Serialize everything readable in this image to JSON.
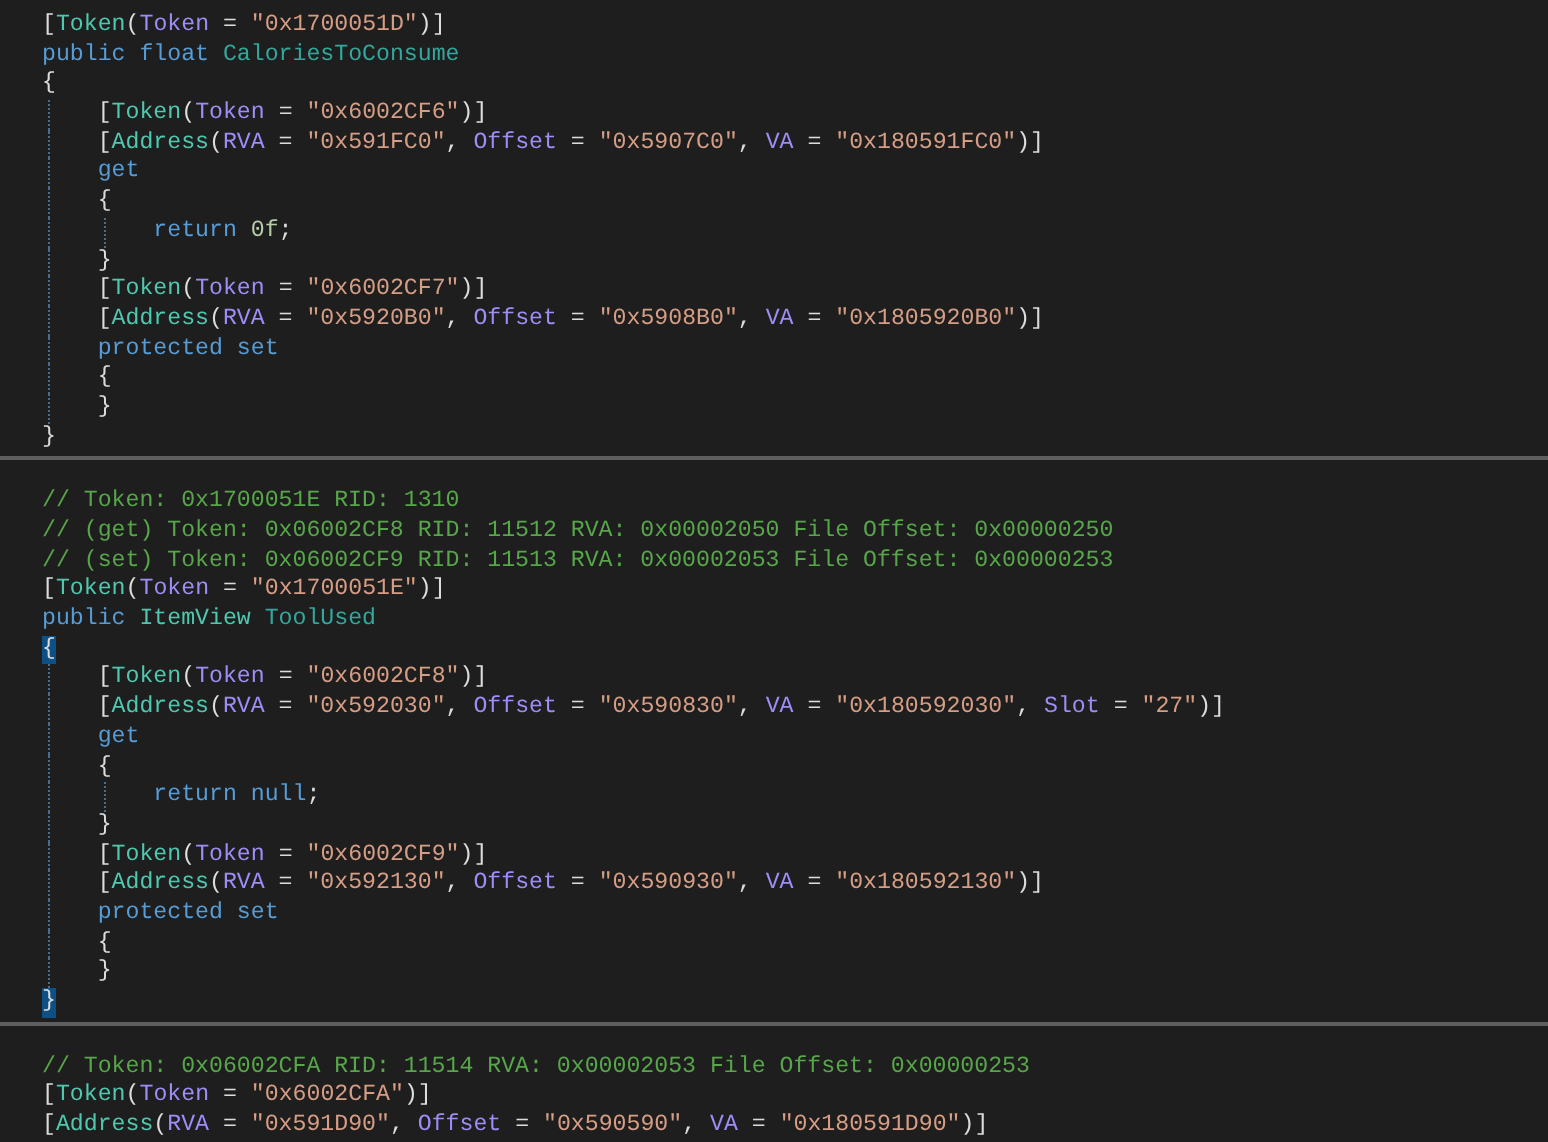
{
  "members": [
    {
      "lines": [
        [
          {
            "kind": "punct",
            "text": "["
          },
          {
            "kind": "attr",
            "text": "Token"
          },
          {
            "kind": "punct",
            "text": "("
          },
          {
            "kind": "param",
            "text": "Token"
          },
          {
            "kind": "punct",
            "text": " = "
          },
          {
            "kind": "string",
            "text": "\"0x1700051D\""
          },
          {
            "kind": "punct",
            "text": ")]"
          }
        ],
        [
          {
            "kind": "keyword",
            "text": "public float "
          },
          {
            "kind": "member",
            "text": "CaloriesToConsume"
          }
        ],
        [
          {
            "kind": "punct",
            "text": "{"
          }
        ],
        [
          {
            "kind": "punct",
            "text": "    ["
          },
          {
            "kind": "attr",
            "text": "Token"
          },
          {
            "kind": "punct",
            "text": "("
          },
          {
            "kind": "param",
            "text": "Token"
          },
          {
            "kind": "punct",
            "text": " = "
          },
          {
            "kind": "string",
            "text": "\"0x6002CF6\""
          },
          {
            "kind": "punct",
            "text": ")]"
          }
        ],
        [
          {
            "kind": "punct",
            "text": "    ["
          },
          {
            "kind": "attr",
            "text": "Address"
          },
          {
            "kind": "punct",
            "text": "("
          },
          {
            "kind": "param",
            "text": "RVA"
          },
          {
            "kind": "punct",
            "text": " = "
          },
          {
            "kind": "string",
            "text": "\"0x591FC0\""
          },
          {
            "kind": "punct",
            "text": ", "
          },
          {
            "kind": "param",
            "text": "Offset"
          },
          {
            "kind": "punct",
            "text": " = "
          },
          {
            "kind": "string",
            "text": "\"0x5907C0\""
          },
          {
            "kind": "punct",
            "text": ", "
          },
          {
            "kind": "param",
            "text": "VA"
          },
          {
            "kind": "punct",
            "text": " = "
          },
          {
            "kind": "string",
            "text": "\"0x180591FC0\""
          },
          {
            "kind": "punct",
            "text": ")]"
          }
        ],
        [
          {
            "kind": "keyword",
            "text": "    get"
          }
        ],
        [
          {
            "kind": "punct",
            "text": "    {"
          }
        ],
        [
          {
            "kind": "keyword",
            "text": "        return "
          },
          {
            "kind": "number",
            "text": "0f"
          },
          {
            "kind": "punct",
            "text": ";"
          }
        ],
        [
          {
            "kind": "punct",
            "text": "    }"
          }
        ],
        [
          {
            "kind": "punct",
            "text": "    ["
          },
          {
            "kind": "attr",
            "text": "Token"
          },
          {
            "kind": "punct",
            "text": "("
          },
          {
            "kind": "param",
            "text": "Token"
          },
          {
            "kind": "punct",
            "text": " = "
          },
          {
            "kind": "string",
            "text": "\"0x6002CF7\""
          },
          {
            "kind": "punct",
            "text": ")]"
          }
        ],
        [
          {
            "kind": "punct",
            "text": "    ["
          },
          {
            "kind": "attr",
            "text": "Address"
          },
          {
            "kind": "punct",
            "text": "("
          },
          {
            "kind": "param",
            "text": "RVA"
          },
          {
            "kind": "punct",
            "text": " = "
          },
          {
            "kind": "string",
            "text": "\"0x5920B0\""
          },
          {
            "kind": "punct",
            "text": ", "
          },
          {
            "kind": "param",
            "text": "Offset"
          },
          {
            "kind": "punct",
            "text": " = "
          },
          {
            "kind": "string",
            "text": "\"0x5908B0\""
          },
          {
            "kind": "punct",
            "text": ", "
          },
          {
            "kind": "param",
            "text": "VA"
          },
          {
            "kind": "punct",
            "text": " = "
          },
          {
            "kind": "string",
            "text": "\"0x1805920B0\""
          },
          {
            "kind": "punct",
            "text": ")]"
          }
        ],
        [
          {
            "kind": "keyword",
            "text": "    protected set"
          }
        ],
        [
          {
            "kind": "punct",
            "text": "    {"
          }
        ],
        [
          {
            "kind": "punct",
            "text": "    }"
          }
        ],
        [
          {
            "kind": "punct",
            "text": "}"
          }
        ]
      ]
    },
    {
      "lines": [
        [
          {
            "kind": "comment",
            "text": "// Token: 0x1700051E RID: 1310"
          }
        ],
        [
          {
            "kind": "comment",
            "text": "// (get) Token: 0x06002CF8 RID: 11512 RVA: 0x00002050 File Offset: 0x00000250"
          }
        ],
        [
          {
            "kind": "comment",
            "text": "// (set) Token: 0x06002CF9 RID: 11513 RVA: 0x00002053 File Offset: 0x00000253"
          }
        ],
        [
          {
            "kind": "punct",
            "text": "["
          },
          {
            "kind": "attr",
            "text": "Token"
          },
          {
            "kind": "punct",
            "text": "("
          },
          {
            "kind": "param",
            "text": "Token"
          },
          {
            "kind": "punct",
            "text": " = "
          },
          {
            "kind": "string",
            "text": "\"0x1700051E\""
          },
          {
            "kind": "punct",
            "text": ")]"
          }
        ],
        [
          {
            "kind": "keyword",
            "text": "public "
          },
          {
            "kind": "type",
            "text": "ItemView "
          },
          {
            "kind": "member",
            "text": "ToolUsed"
          }
        ],
        [
          {
            "kind": "brace-match",
            "text": "{"
          }
        ],
        [
          {
            "kind": "punct",
            "text": "    ["
          },
          {
            "kind": "attr",
            "text": "Token"
          },
          {
            "kind": "punct",
            "text": "("
          },
          {
            "kind": "param",
            "text": "Token"
          },
          {
            "kind": "punct",
            "text": " = "
          },
          {
            "kind": "string",
            "text": "\"0x6002CF8\""
          },
          {
            "kind": "punct",
            "text": ")]"
          }
        ],
        [
          {
            "kind": "punct",
            "text": "    ["
          },
          {
            "kind": "attr",
            "text": "Address"
          },
          {
            "kind": "punct",
            "text": "("
          },
          {
            "kind": "param",
            "text": "RVA"
          },
          {
            "kind": "punct",
            "text": " = "
          },
          {
            "kind": "string",
            "text": "\"0x592030\""
          },
          {
            "kind": "punct",
            "text": ", "
          },
          {
            "kind": "param",
            "text": "Offset"
          },
          {
            "kind": "punct",
            "text": " = "
          },
          {
            "kind": "string",
            "text": "\"0x590830\""
          },
          {
            "kind": "punct",
            "text": ", "
          },
          {
            "kind": "param",
            "text": "VA"
          },
          {
            "kind": "punct",
            "text": " = "
          },
          {
            "kind": "string",
            "text": "\"0x180592030\""
          },
          {
            "kind": "punct",
            "text": ", "
          },
          {
            "kind": "param",
            "text": "Slot"
          },
          {
            "kind": "punct",
            "text": " = "
          },
          {
            "kind": "string",
            "text": "\"27\""
          },
          {
            "kind": "punct",
            "text": ")]"
          }
        ],
        [
          {
            "kind": "keyword",
            "text": "    get"
          }
        ],
        [
          {
            "kind": "punct",
            "text": "    {"
          }
        ],
        [
          {
            "kind": "keyword",
            "text": "        return null"
          },
          {
            "kind": "punct",
            "text": ";"
          }
        ],
        [
          {
            "kind": "punct",
            "text": "    }"
          }
        ],
        [
          {
            "kind": "punct",
            "text": "    ["
          },
          {
            "kind": "attr",
            "text": "Token"
          },
          {
            "kind": "punct",
            "text": "("
          },
          {
            "kind": "param",
            "text": "Token"
          },
          {
            "kind": "punct",
            "text": " = "
          },
          {
            "kind": "string",
            "text": "\"0x6002CF9\""
          },
          {
            "kind": "punct",
            "text": ")]"
          }
        ],
        [
          {
            "kind": "punct",
            "text": "    ["
          },
          {
            "kind": "attr",
            "text": "Address"
          },
          {
            "kind": "punct",
            "text": "("
          },
          {
            "kind": "param",
            "text": "RVA"
          },
          {
            "kind": "punct",
            "text": " = "
          },
          {
            "kind": "string",
            "text": "\"0x592130\""
          },
          {
            "kind": "punct",
            "text": ", "
          },
          {
            "kind": "param",
            "text": "Offset"
          },
          {
            "kind": "punct",
            "text": " = "
          },
          {
            "kind": "string",
            "text": "\"0x590930\""
          },
          {
            "kind": "punct",
            "text": ", "
          },
          {
            "kind": "param",
            "text": "VA"
          },
          {
            "kind": "punct",
            "text": " = "
          },
          {
            "kind": "string",
            "text": "\"0x180592130\""
          },
          {
            "kind": "punct",
            "text": ")]"
          }
        ],
        [
          {
            "kind": "keyword",
            "text": "    protected set"
          }
        ],
        [
          {
            "kind": "punct",
            "text": "    {"
          }
        ],
        [
          {
            "kind": "punct",
            "text": "    }"
          }
        ],
        [
          {
            "kind": "brace-match",
            "text": "}"
          }
        ]
      ]
    },
    {
      "lines": [
        [
          {
            "kind": "comment",
            "text": "// Token: 0x06002CFA RID: 11514 RVA: 0x00002053 File Offset: 0x00000253"
          }
        ],
        [
          {
            "kind": "punct",
            "text": "["
          },
          {
            "kind": "attr",
            "text": "Token"
          },
          {
            "kind": "punct",
            "text": "("
          },
          {
            "kind": "param",
            "text": "Token"
          },
          {
            "kind": "punct",
            "text": " = "
          },
          {
            "kind": "string",
            "text": "\"0x6002CFA\""
          },
          {
            "kind": "punct",
            "text": ")]"
          }
        ],
        [
          {
            "kind": "punct",
            "text": "["
          },
          {
            "kind": "attr",
            "text": "Address"
          },
          {
            "kind": "punct",
            "text": "("
          },
          {
            "kind": "param",
            "text": "RVA"
          },
          {
            "kind": "punct",
            "text": " = "
          },
          {
            "kind": "string",
            "text": "\"0x591D90\""
          },
          {
            "kind": "punct",
            "text": ", "
          },
          {
            "kind": "param",
            "text": "Offset"
          },
          {
            "kind": "punct",
            "text": " = "
          },
          {
            "kind": "string",
            "text": "\"0x590590\""
          },
          {
            "kind": "punct",
            "text": ", "
          },
          {
            "kind": "param",
            "text": "VA"
          },
          {
            "kind": "punct",
            "text": " = "
          },
          {
            "kind": "string",
            "text": "\"0x180591D90\""
          },
          {
            "kind": "punct",
            "text": ")]"
          }
        ]
      ]
    }
  ]
}
